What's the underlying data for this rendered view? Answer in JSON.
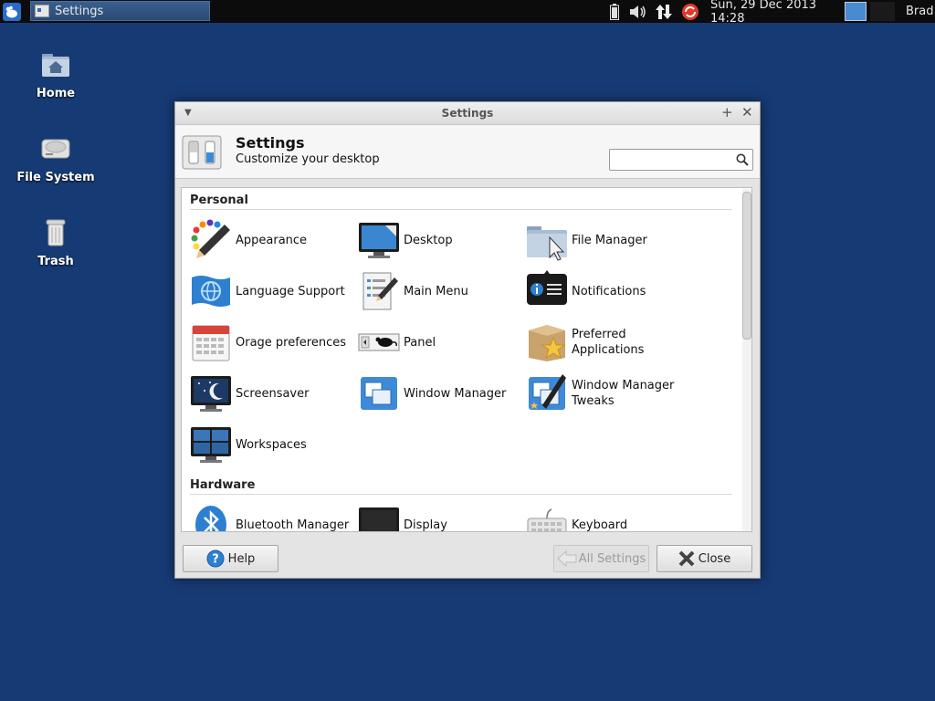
{
  "panel": {
    "task_title": "Settings",
    "clock": "Sun, 29 Dec 2013 14:28",
    "user": "Brad"
  },
  "desktop": {
    "icons": [
      {
        "label": "Home"
      },
      {
        "label": "File System"
      },
      {
        "label": "Trash"
      }
    ]
  },
  "window": {
    "title": "Settings",
    "header_title": "Settings",
    "header_subtitle": "Customize your desktop",
    "search_value": ""
  },
  "sections": {
    "personal": {
      "title": "Personal",
      "items": [
        {
          "label": "Appearance",
          "icon": "appearance-icon"
        },
        {
          "label": "Desktop",
          "icon": "desktop-icon"
        },
        {
          "label": "File Manager",
          "icon": "file-manager-icon"
        },
        {
          "label": "Language Support",
          "icon": "language-support-icon"
        },
        {
          "label": "Main Menu",
          "icon": "main-menu-icon"
        },
        {
          "label": "Notifications",
          "icon": "notifications-icon"
        },
        {
          "label": "Orage preferences",
          "icon": "calendar-icon"
        },
        {
          "label": "Panel",
          "icon": "panel-icon"
        },
        {
          "label": "Preferred Applications",
          "icon": "preferred-applications-icon"
        },
        {
          "label": "Screensaver",
          "icon": "screensaver-icon"
        },
        {
          "label": "Window Manager",
          "icon": "window-manager-icon"
        },
        {
          "label": "Window Manager Tweaks",
          "icon": "window-manager-tweaks-icon"
        },
        {
          "label": "Workspaces",
          "icon": "workspaces-icon"
        }
      ]
    },
    "hardware": {
      "title": "Hardware",
      "items": [
        {
          "label": "Bluetooth Manager",
          "icon": "bluetooth-icon"
        },
        {
          "label": "Display",
          "icon": "display-icon"
        },
        {
          "label": "Keyboard",
          "icon": "keyboard-icon"
        }
      ]
    }
  },
  "buttons": {
    "help": "Help",
    "all_settings": "All Settings",
    "close": "Close"
  },
  "colors": {
    "desktop_bg": "#163a73",
    "panel_bg": "#0c0c0c"
  }
}
